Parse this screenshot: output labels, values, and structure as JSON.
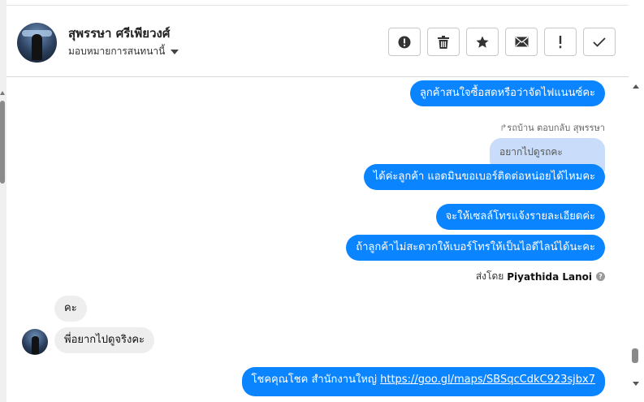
{
  "contact": {
    "name": "สุพรรษา ศรีเพียวงศ์",
    "assign_label": "มอบหมายการสนทนานี้"
  },
  "header_actions": [
    {
      "name": "alert-icon"
    },
    {
      "name": "trash-icon"
    },
    {
      "name": "star-icon"
    },
    {
      "name": "envelope-icon"
    },
    {
      "name": "exclamation-icon"
    },
    {
      "name": "checkmark-icon"
    }
  ],
  "messages": {
    "out_1": "ลูกค้าสนใจซื้อสดหรือว่าจัดไฟแนนซ์คะ",
    "reply_note": "รถบ้าน ตอบกลับ สุพรรษา",
    "quoted": "อยากไปดูรถคะ",
    "out_2": "ได้ค่ะลูกค้า แอดมินขอเบอร์ติดต่อหน่อยได้ไหมคะ",
    "out_3": "จะให้เซลล์โทรแจ้งรายละเอียดค่ะ",
    "out_4": "ถ้าลูกค้าไม่สะดวกให้เบอร์โทรให้เป็นไอดีไลน์ได้นะคะ",
    "sent_by_label": "ส่งโดย",
    "sent_by_name": "Piyathida Lanoi",
    "in_1": "คะ",
    "in_2": "พี่อยากไปดูจริงคะ",
    "out_5_text": "โชคคุณโชค สำนักงานใหญ่",
    "out_5_link": "https://goo.gl/maps/SBSqcCdkC923sjbx7"
  },
  "colors": {
    "outgoing_bubble": "#0b84ff",
    "incoming_bubble": "#eeeeee",
    "quoted_bubble": "#c9ddfa"
  }
}
